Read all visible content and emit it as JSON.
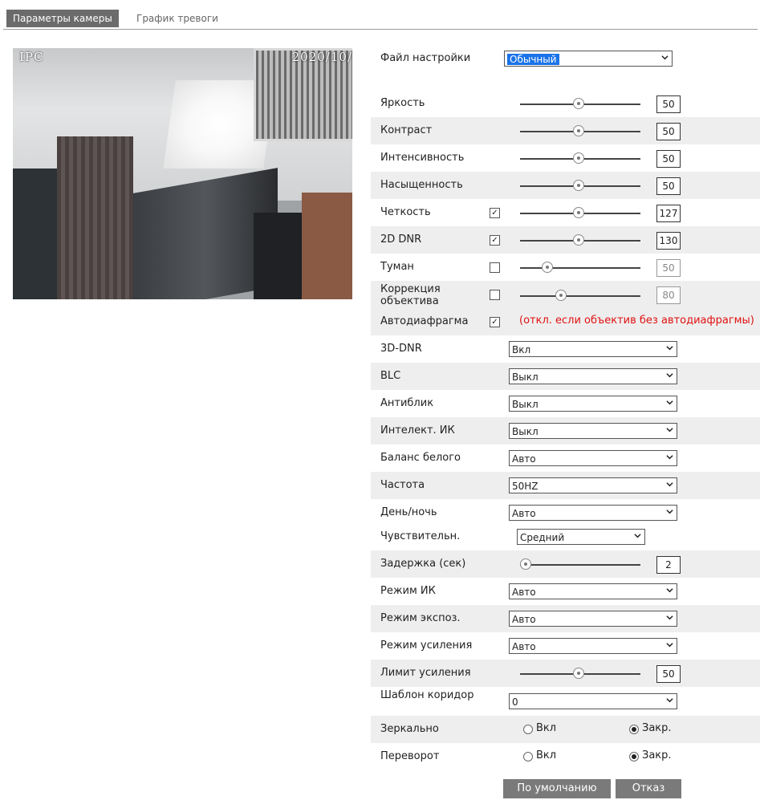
{
  "tabs": {
    "active": "Параметры камеры",
    "inactive": "График тревоги"
  },
  "preview": {
    "osd_left": "IPC",
    "osd_right": "2020/10/"
  },
  "profile": {
    "label": "Файл настройки",
    "value": "Обычный"
  },
  "sliders": [
    {
      "label": "Яркость",
      "value": "50",
      "level": 0.48
    },
    {
      "label": "Контраст",
      "value": "50",
      "level": 0.48
    },
    {
      "label": "Интенсивность",
      "value": "50",
      "level": 0.48
    },
    {
      "label": "Насыщенность",
      "value": "50",
      "level": 0.48
    },
    {
      "label": "Четкость",
      "value": "127",
      "level": 0.48,
      "checked": true
    },
    {
      "label": "2D DNR",
      "value": "130",
      "level": 0.48,
      "checked": true
    },
    {
      "label": "Туман",
      "value": "50",
      "level": 0.22,
      "checked": false
    },
    {
      "label": "Коррекция объектива",
      "value": "80",
      "level": 0.33,
      "checked": false
    }
  ],
  "iris": {
    "label": "Автодиафрагма",
    "checked": true,
    "note": "(откл. если объектив без автодиафрагмы)"
  },
  "selects": [
    {
      "label": "3D-DNR",
      "value": "Вкл"
    },
    {
      "label": "BLC",
      "value": "Выкл"
    },
    {
      "label": "Антиблик",
      "value": "Выкл"
    },
    {
      "label": "Интелект. ИК",
      "value": "Выкл"
    },
    {
      "label": "Баланс белого",
      "value": "Авто"
    },
    {
      "label": "Частота",
      "value": "50HZ"
    },
    {
      "label": "День/ночь",
      "value": "Авто"
    }
  ],
  "sensitivity": {
    "label": "Чувствительн.",
    "value": "Средний"
  },
  "delay": {
    "label": "Задержка (сек)",
    "value": "2",
    "level": 0.04
  },
  "selects2": [
    {
      "label": "Режим ИК",
      "value": "Авто"
    },
    {
      "label": "Режим экспоз.",
      "value": "Авто"
    },
    {
      "label": "Режим усиления",
      "value": "Авто"
    }
  ],
  "gain_limit": {
    "label": "Лимит усиления",
    "value": "50",
    "level": 0.48
  },
  "corridor": {
    "label": "Шаблон коридор",
    "value": "0"
  },
  "mirror": {
    "label": "Зеркально",
    "on": "Вкл",
    "off": "Закр.",
    "selected": "off"
  },
  "flip": {
    "label": "Переворот",
    "on": "Вкл",
    "off": "Закр.",
    "selected": "off"
  },
  "buttons": {
    "default": "По умолчанию",
    "cancel": "Отказ"
  },
  "colors": {
    "accent": "#1a73e8",
    "warning": "#e01010",
    "button": "#7a7a7a"
  }
}
